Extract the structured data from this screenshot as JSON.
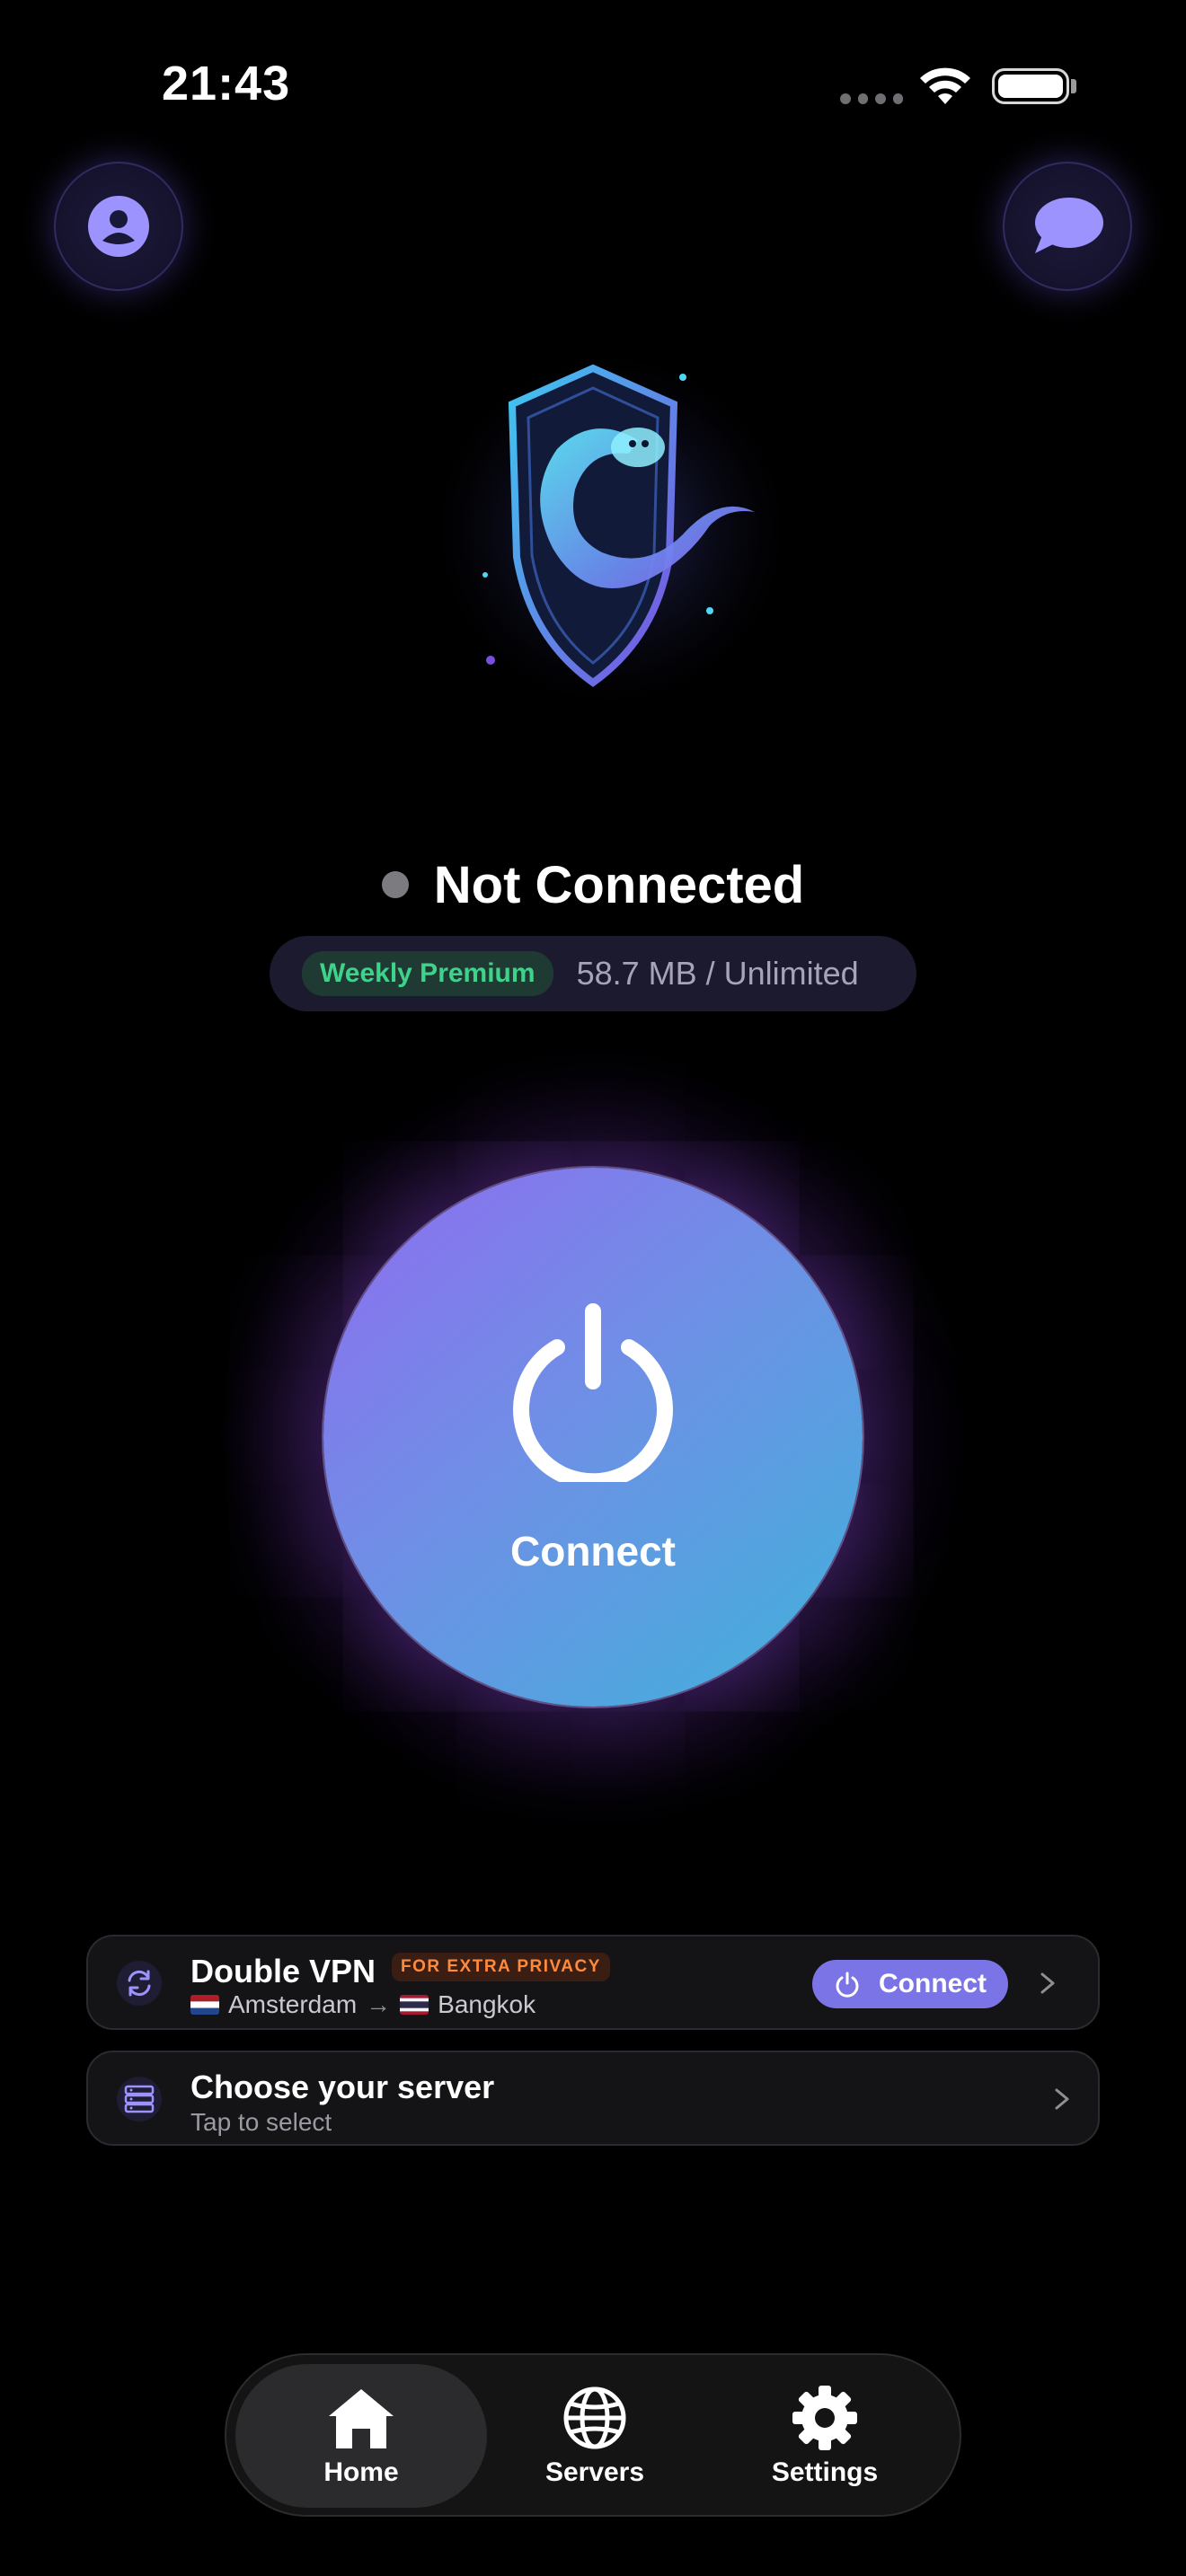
{
  "status_bar": {
    "time": "21:43"
  },
  "connection": {
    "status": "Not Connected",
    "plan_badge": "Weekly Premium",
    "usage": "58.7 MB / Unlimited",
    "button_label": "Connect"
  },
  "double_vpn": {
    "title": "Double VPN",
    "badge": "FOR EXTRA PRIVACY",
    "from": "Amsterdam",
    "arrow": "→",
    "to": "Bangkok",
    "connect_label": "Connect"
  },
  "server_card": {
    "title": "Choose your server",
    "subtitle": "Tap to select"
  },
  "tabs": [
    {
      "label": "Home",
      "icon": "home-icon",
      "active": true
    },
    {
      "label": "Servers",
      "icon": "globe-icon",
      "active": false
    },
    {
      "label": "Settings",
      "icon": "gear-icon",
      "active": false
    }
  ],
  "colors": {
    "accent": "#7b74e6",
    "plan_badge_text": "#3fd28a",
    "privacy_badge_text": "#ff8a3d"
  }
}
